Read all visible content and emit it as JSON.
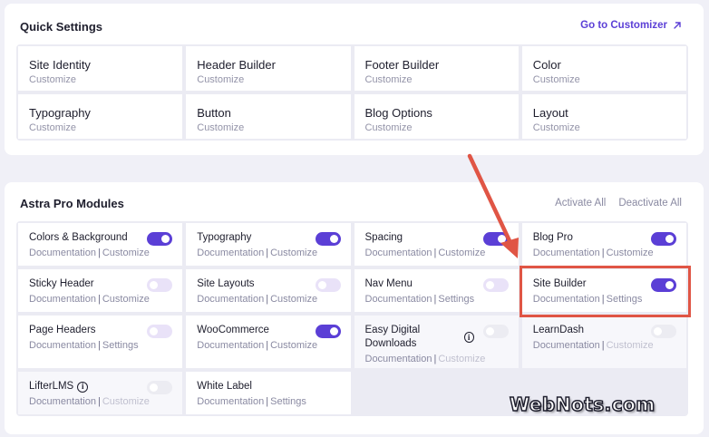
{
  "quick_settings": {
    "title": "Quick Settings",
    "customizer_link": "Go to Customizer",
    "items": [
      {
        "title": "Site Identity",
        "sub": "Customize"
      },
      {
        "title": "Header Builder",
        "sub": "Customize"
      },
      {
        "title": "Footer Builder",
        "sub": "Customize"
      },
      {
        "title": "Color",
        "sub": "Customize"
      },
      {
        "title": "Typography",
        "sub": "Customize"
      },
      {
        "title": "Button",
        "sub": "Customize"
      },
      {
        "title": "Blog Options",
        "sub": "Customize"
      },
      {
        "title": "Layout",
        "sub": "Customize"
      }
    ]
  },
  "pro_modules": {
    "title": "Astra Pro Modules",
    "activate_all": "Activate All",
    "deactivate_all": "Deactivate All",
    "separator": "|",
    "modules": [
      {
        "title": "Colors & Background",
        "doc": "Documentation",
        "action": "Customize",
        "state": "on"
      },
      {
        "title": "Typography",
        "doc": "Documentation",
        "action": "Customize",
        "state": "on"
      },
      {
        "title": "Spacing",
        "doc": "Documentation",
        "action": "Customize",
        "state": "on"
      },
      {
        "title": "Blog Pro",
        "doc": "Documentation",
        "action": "Customize",
        "state": "on"
      },
      {
        "title": "Sticky Header",
        "doc": "Documentation",
        "action": "Customize",
        "state": "off"
      },
      {
        "title": "Site Layouts",
        "doc": "Documentation",
        "action": "Customize",
        "state": "off"
      },
      {
        "title": "Nav Menu",
        "doc": "Documentation",
        "action": "Settings",
        "state": "off"
      },
      {
        "title": "Site Builder",
        "doc": "Documentation",
        "action": "Settings",
        "state": "on"
      },
      {
        "title": "Page Headers",
        "doc": "Documentation",
        "action": "Settings",
        "state": "off"
      },
      {
        "title": "WooCommerce",
        "doc": "Documentation",
        "action": "Customize",
        "state": "on"
      },
      {
        "title": "Easy Digital Downloads",
        "doc": "Documentation",
        "action": "Customize",
        "state": "disabled"
      },
      {
        "title": "LearnDash",
        "doc": "Documentation",
        "action": "Customize",
        "state": "disabled"
      },
      {
        "title": "LifterLMS",
        "doc": "Documentation",
        "action": "Customize",
        "state": "disabled"
      },
      {
        "title": "White Label",
        "doc": "Documentation",
        "action": "Settings",
        "state": "none"
      }
    ]
  },
  "watermark": "WebNots.com",
  "colors": {
    "accent": "#5b3fd6",
    "highlight": "#e05545",
    "background": "#f0f0f7"
  }
}
